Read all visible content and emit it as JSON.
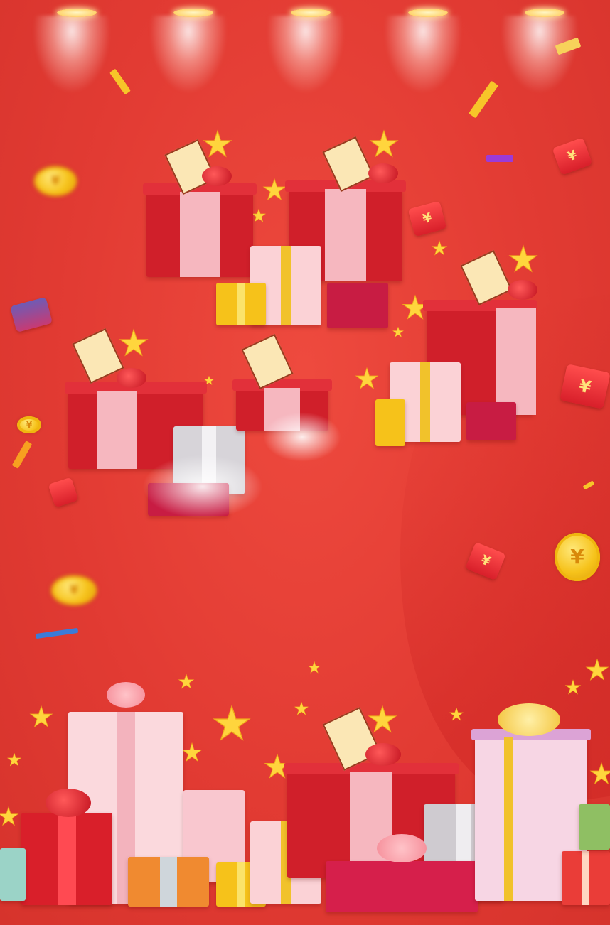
{
  "colors": {
    "background": "#e23b33",
    "gold": "#f6c21a",
    "red_box": "#d01f2a",
    "pink_box": "#f6b7bf",
    "star": "#ffd53d"
  },
  "envelope_symbol": "¥",
  "coin_symbol": "¥",
  "icons": [
    "spotlight-icon",
    "coin-icon",
    "red-envelope-icon",
    "star-icon",
    "gift-box-icon",
    "confetti-icon"
  ]
}
